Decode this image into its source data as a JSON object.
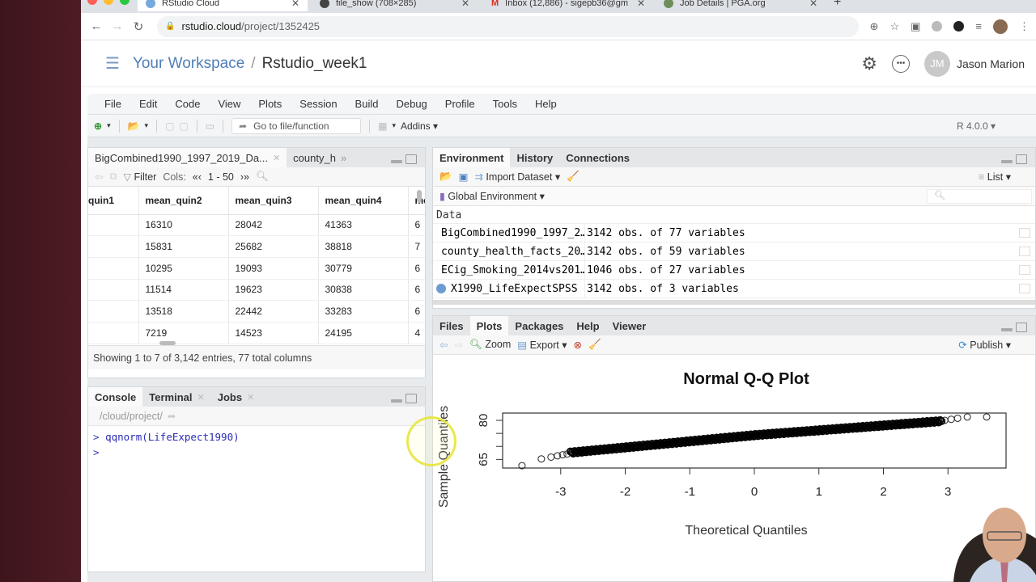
{
  "browser": {
    "tabs": [
      {
        "title": "RStudio Cloud",
        "active": true,
        "favicon_color": "#75aadb"
      },
      {
        "title": "file_show (708×285)",
        "active": false,
        "favicon_color": "#444444"
      },
      {
        "title": "Inbox (12,886) - sigepb36@gm",
        "active": false,
        "favicon_color": "#d93025"
      },
      {
        "title": "Job Details | PGA.org",
        "active": false,
        "favicon_color": "#6b8e5a"
      }
    ],
    "new_tab_icon": "+",
    "url_host": "rstudio.cloud",
    "url_path": "/project/1352425",
    "nav": {
      "back": "←",
      "forward": "→",
      "reload": "C"
    }
  },
  "cloud_header": {
    "workspace_label": "Your Workspace",
    "separator": "/",
    "project_name": "Rstudio_week1",
    "user_initials": "JM",
    "user_name": "Jason Marion"
  },
  "ide": {
    "menu": [
      "File",
      "Edit",
      "Code",
      "View",
      "Plots",
      "Session",
      "Build",
      "Debug",
      "Profile",
      "Tools",
      "Help"
    ],
    "toolbar": {
      "goto_placeholder": "Go to file/function",
      "addins_label": "Addins",
      "r_version": "R 4.0.0"
    },
    "source_pane": {
      "tabs": [
        {
          "label": "BigCombined1990_1997_2019_Da...",
          "closable": true
        },
        {
          "label": "county_h",
          "closable": false
        }
      ],
      "overflow": "»",
      "filter_label": "Filter",
      "cols_label": "Cols:",
      "cols_range": "1 - 50",
      "columns": [
        "quin1",
        "mean_quin2",
        "mean_quin3",
        "mean_quin4",
        "me"
      ],
      "rows": [
        [
          "",
          "16310",
          "28042",
          "41363",
          "6"
        ],
        [
          "",
          "15831",
          "25682",
          "38818",
          "7"
        ],
        [
          "",
          "10295",
          "19093",
          "30779",
          "6"
        ],
        [
          "",
          "11514",
          "19623",
          "30838",
          "6"
        ],
        [
          "",
          "13518",
          "22442",
          "33283",
          "6"
        ],
        [
          "",
          "7219",
          "14523",
          "24195",
          "4"
        ]
      ],
      "status": "Showing 1 to 7 of 3,142 entries, 77 total columns"
    },
    "console_pane": {
      "tabs": [
        {
          "label": "Console",
          "closable": false
        },
        {
          "label": "Terminal",
          "closable": true
        },
        {
          "label": "Jobs",
          "closable": true
        }
      ],
      "path": "/cloud/project/",
      "lines": [
        {
          "prompt": ">",
          "code": "qqnorm(LifeExpect1990)"
        },
        {
          "prompt": ">",
          "code": ""
        }
      ]
    },
    "env_pane": {
      "tabs": [
        "Environment",
        "History",
        "Connections"
      ],
      "import_label": "Import Dataset",
      "view_mode": "List",
      "scope": "Global Environment",
      "section": "Data",
      "items": [
        {
          "name": "BigCombined1990_1997_2…",
          "value": "3142 obs. of 77 variables"
        },
        {
          "name": "county_health_facts_20…",
          "value": "3142 obs. of 59 variables"
        },
        {
          "name": "ECig_Smoking_2014vs201…",
          "value": "1046 obs. of 27 variables"
        },
        {
          "name": "X1990_LifeExpectSPSS",
          "value": "3142 obs. of 3 variables"
        }
      ]
    },
    "plots_pane": {
      "tabs": [
        "Files",
        "Plots",
        "Packages",
        "Help",
        "Viewer"
      ],
      "zoom_label": "Zoom",
      "export_label": "Export",
      "publish_label": "Publish"
    }
  },
  "chart_data": {
    "type": "scatter",
    "title": "Normal Q-Q Plot",
    "xlabel": "Theoretical Quantiles",
    "ylabel": "Sample Quantiles",
    "xlim": [
      -3.9,
      3.9
    ],
    "ylim": [
      61.7,
      82.8
    ],
    "xticks": [
      -3,
      -2,
      -1,
      0,
      1,
      2,
      3
    ],
    "yticks": [
      65,
      70,
      75,
      80
    ],
    "ytick_labels": [
      "65",
      "",
      "",
      "80"
    ],
    "n_points": 3142,
    "marker": "open-circle",
    "tail_points": [
      {
        "x": -3.6,
        "y": 62.6
      },
      {
        "x": -3.3,
        "y": 65.2
      },
      {
        "x": -3.15,
        "y": 65.9
      },
      {
        "x": -3.05,
        "y": 66.4
      },
      {
        "x": -2.97,
        "y": 66.8
      },
      {
        "x": -2.9,
        "y": 67.1
      },
      {
        "x": 2.95,
        "y": 80.0
      },
      {
        "x": 3.05,
        "y": 80.4
      },
      {
        "x": 3.15,
        "y": 80.8
      },
      {
        "x": 3.3,
        "y": 81.3
      },
      {
        "x": 3.6,
        "y": 81.3
      }
    ],
    "body_trend": {
      "x_start": -2.85,
      "y_start": 67.6,
      "x_mid": 0,
      "y_mid": 74.3,
      "x_end": 2.9,
      "y_end": 79.7
    }
  }
}
